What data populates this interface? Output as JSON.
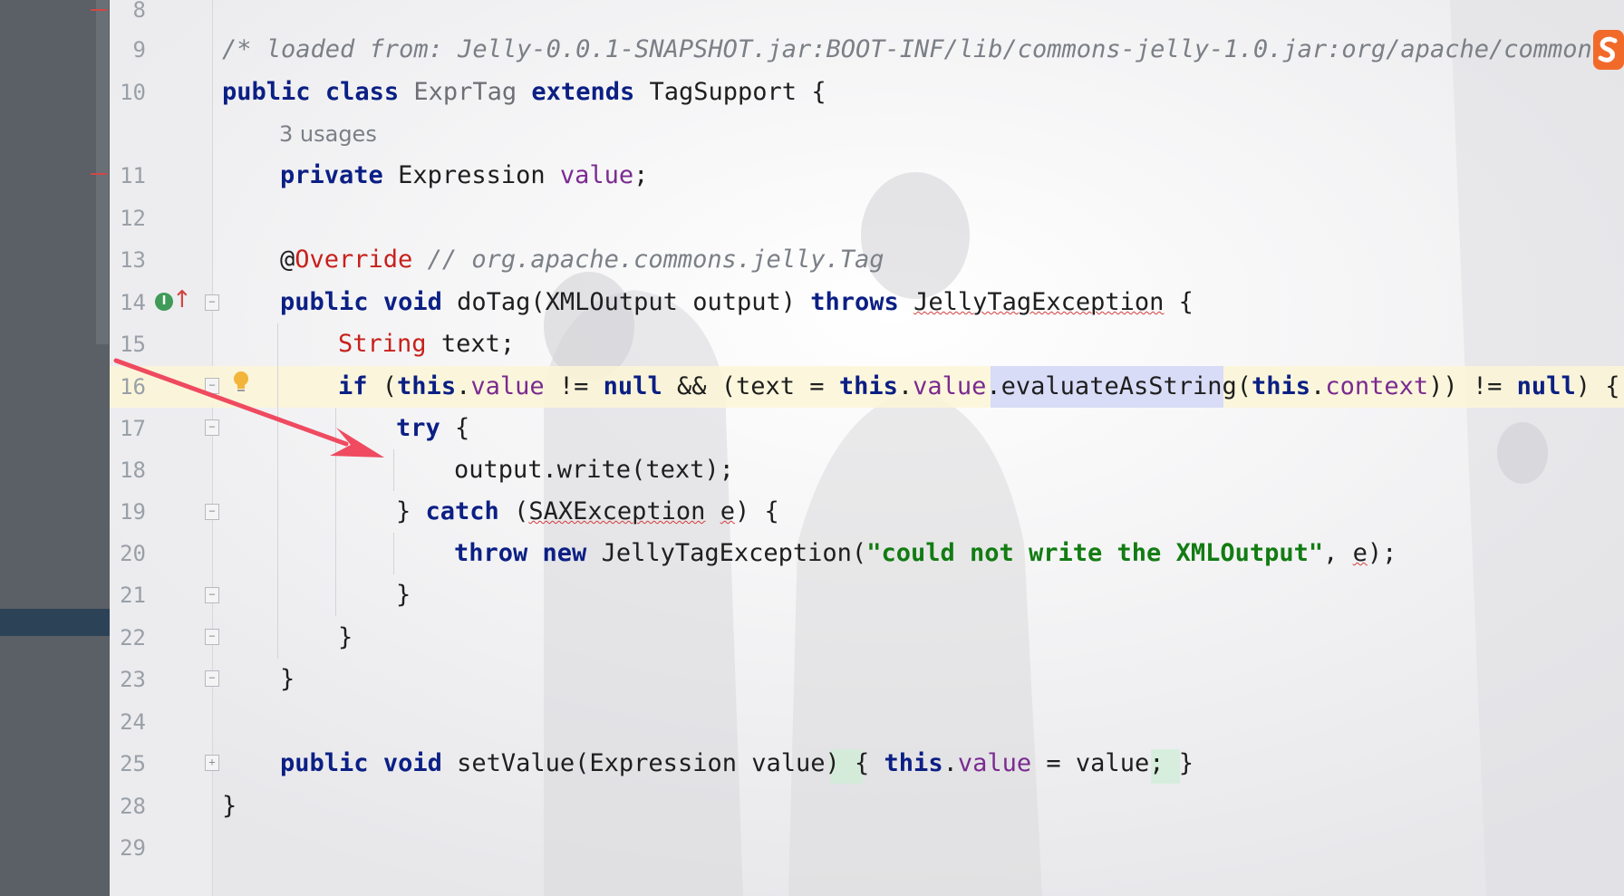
{
  "editor": {
    "usages_hint": "3 usages",
    "lines": [
      {
        "num": "8"
      },
      {
        "num": "9"
      },
      {
        "num": "10"
      },
      {
        "num": "11"
      },
      {
        "num": "12"
      },
      {
        "num": "13"
      },
      {
        "num": "14"
      },
      {
        "num": "15"
      },
      {
        "num": "16"
      },
      {
        "num": "17"
      },
      {
        "num": "18"
      },
      {
        "num": "19"
      },
      {
        "num": "20"
      },
      {
        "num": "21"
      },
      {
        "num": "22"
      },
      {
        "num": "23"
      },
      {
        "num": "24"
      },
      {
        "num": "25"
      },
      {
        "num": "28"
      },
      {
        "num": "29"
      }
    ],
    "code": {
      "l9_comment": "/* loaded from: Jelly-0.0.1-SNAPSHOT.jar:BOOT-INF/lib/commons-jelly-1.0.jar:org/apache/commons/",
      "kw_public": "public",
      "kw_class": "class",
      "class_name": "ExprTag",
      "kw_extends": "extends",
      "super_class": "TagSupport",
      "brace_open": "{",
      "brace_close": "}",
      "kw_private": "private",
      "type_expression": "Expression",
      "field_value": "value",
      "semicolon": ";",
      "annotation_at": "@",
      "annotation_name": "Override",
      "l13_comment": "// org.apache.commons.jelly.Tag",
      "kw_void": "void",
      "method_dotag": "doTag(XMLOutput output)",
      "kw_throws": "throws",
      "exc_jelly": "JellyTagException",
      "type_string": "String",
      "var_text_decl": "text;",
      "kw_if": "if",
      "paren_open": "(",
      "kw_this": "this",
      "dot": ".",
      "op_neq": "!=",
      "kw_null": "null",
      "op_and": "&&",
      "text_assign": "(text =",
      "method_eval": "evaluateAsString",
      "field_context": "context",
      "close_parens": "))",
      "close_brace_tail": ") {",
      "kw_try": "try",
      "stmt_write": "output.write(text);",
      "kw_catch": "catch",
      "exc_sax": "SAXException",
      "var_e": "e",
      "kw_throw": "throw",
      "kw_new": "new",
      "ctor_jelly": "JellyTagException(",
      "str_msg": "\"could not write the XMLOutput\"",
      "comma": ",",
      "call_end": ");",
      "method_setvalue": "setValue(Expression value)",
      "assign_eq": "=",
      "param_value": "value;"
    }
  },
  "colors": {
    "keyword": "#0b1f84",
    "field": "#7b2a90",
    "string": "#127c12",
    "annotation": "#c8201b",
    "comment": "#7b7f86",
    "arrow": "#ef4a5f"
  },
  "icons": [
    "implements-marker-icon",
    "override-up-arrow-icon",
    "lightbulb-icon",
    "app-logo-icon",
    "fold-icon",
    "red-arrow-annotation"
  ]
}
